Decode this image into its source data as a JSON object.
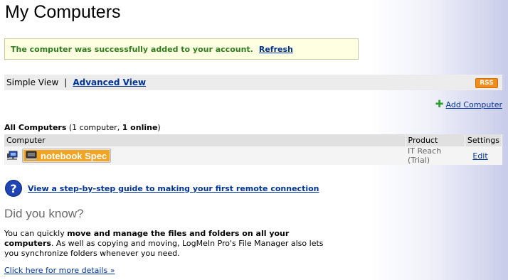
{
  "page_title": "My Computers",
  "success": {
    "message": "The computer was successfully added to your account.",
    "refresh_label": "Refresh"
  },
  "view_bar": {
    "simple_label": "Simple View",
    "separator": "|",
    "advanced_label": "Advanced View",
    "rss_label": "RSS"
  },
  "add_computer_label": "Add Computer",
  "all_computers": {
    "heading": "All Computers",
    "count_open": " (1 computer, ",
    "online_count": "1 online",
    "count_close": ")"
  },
  "table": {
    "headers": [
      "Computer",
      "Product",
      "Settings"
    ],
    "rows": [
      {
        "name": "notebook Spec",
        "product": "IT Reach (Trial)",
        "settings": "Edit"
      }
    ]
  },
  "guide_label": "View a step-by-step guide to making your first remote connection",
  "did_you_know": {
    "title": "Did you know?",
    "text_1": "You can quickly ",
    "text_bold": "move and manage the files and folders on all your computers",
    "text_2": ". As well as copying and moving, LogMeIn Pro's File Manager also lets you synchronize folders whenever you need.",
    "more_label": "Click here for more details »"
  },
  "colors": {
    "link": "#003399",
    "success_text": "#2e7d1e",
    "rss": "#f28c1c",
    "name_badge": "#f3a422"
  }
}
